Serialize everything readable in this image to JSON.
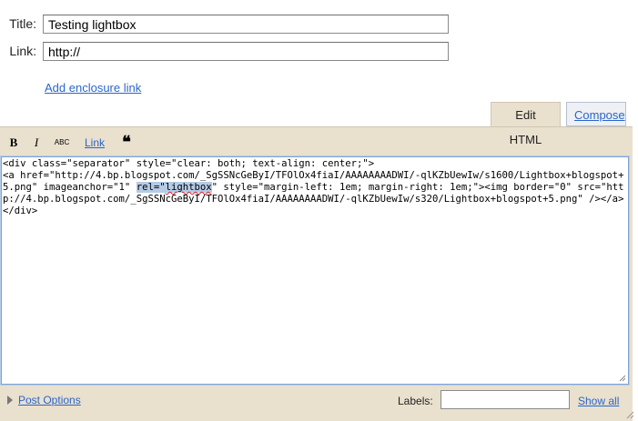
{
  "form": {
    "title_label": "Title:",
    "title_value": "Testing lightbox",
    "link_label": "Link:",
    "link_value": "http://",
    "enclosure_link": "Add enclosure link"
  },
  "tabs": [
    {
      "label": "Edit HTML",
      "active": true
    },
    {
      "label": "Compose",
      "active": false
    }
  ],
  "toolbar": {
    "bold_label": "B",
    "italic_label": "I",
    "spell_label": "ABC",
    "link_label": "Link",
    "quote_label": "❝"
  },
  "editor": {
    "code_before": "<div class=\"separator\" style=\"clear: both; text-align: center;\">\n<a href=\"http://4.bp.blogspot.com/_SgSSNcGeByI/TFOlOx4fiaI/AAAAAAAADWI/-qlKZbUewIw/s1600/Lightbox+blogspot+5.png\" imageanchor=\"1\" ",
    "code_selected_prefix": "rel=\"",
    "code_selected_word": "lightbox",
    "code_after": "\" style=\"margin-left: 1em; margin-right: 1em;\"><img border=\"0\" src=\"http://4.bp.blogspot.com/_SgSSNcGeByI/TFOlOx4fiaI/AAAAAAAADWI/-qlKZbUewIw/s320/Lightbox+blogspot+5.png\" /></a></div>"
  },
  "footer": {
    "post_options": "Post Options",
    "labels_label": "Labels:",
    "labels_value": "",
    "show_all": "Show all"
  },
  "colors": {
    "link": "#2a66c9",
    "editor_frame": "#e9e0ce",
    "selection": "#b5cbe6"
  }
}
